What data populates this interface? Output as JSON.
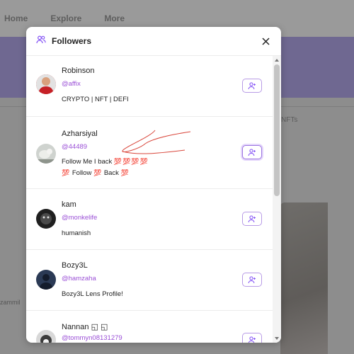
{
  "nav": {
    "home": "Home",
    "explore": "Explore",
    "more": "More"
  },
  "background": {
    "nfts_label": "NFTs",
    "side_name": "zammil"
  },
  "modal": {
    "title": "Followers",
    "close_label": "×"
  },
  "followers": [
    {
      "name": "Robinson",
      "handle": "@affix",
      "bio": "CRYPTO | NFT | DEFI",
      "bio2": ""
    },
    {
      "name": "Azharsiyal",
      "handle": "@44489",
      "bio": "Follow Me I back",
      "bio_hearts": "💯💯💯💯",
      "bio2_pre": "💯",
      "bio2": "Follow",
      "bio2_mid": "💯",
      "bio2_post": "Back",
      "bio2_end": "💯"
    },
    {
      "name": "kam",
      "handle": "@monkelife",
      "bio": "humanish",
      "bio2": ""
    },
    {
      "name": "Bozy3L",
      "handle": "@hamzaha",
      "bio": "Bozy3L Lens Profile!",
      "bio2": ""
    },
    {
      "name": "Nannan ◱ ◱",
      "handle": "@tommyn08131279",
      "bio": "",
      "bio2": ""
    }
  ],
  "icons": {
    "users": "users-icon",
    "close": "close-icon",
    "follow": "user-plus-icon"
  },
  "colors": {
    "accent": "#9a4fd6",
    "banner": "#6f6891",
    "follow_border": "#b89be6"
  }
}
